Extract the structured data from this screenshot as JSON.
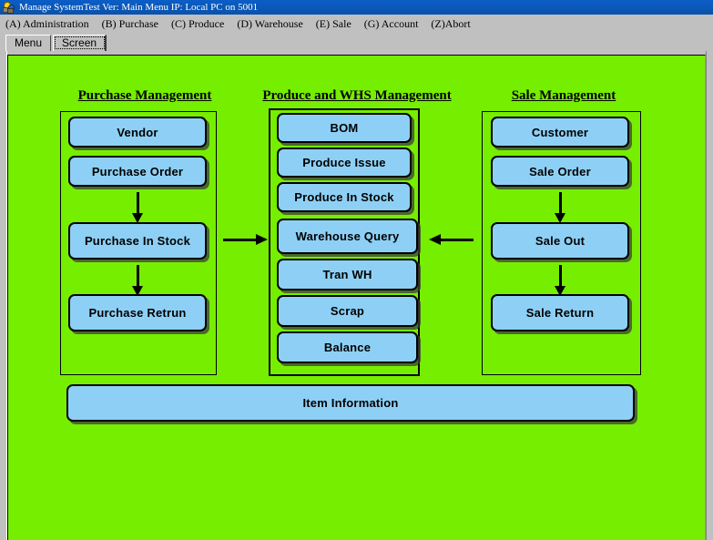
{
  "window": {
    "title": "Manage SystemTest Ver: Main Menu IP: Local PC on 5001",
    "icon": "app-icon",
    "bg_color": "#76ee00",
    "button_color": "#8ed0f5",
    "titlebar_color": "#0a56b5"
  },
  "menubar": {
    "items": [
      {
        "accel": "A",
        "label": "Administration"
      },
      {
        "accel": "B",
        "label": "Purchase"
      },
      {
        "accel": "C",
        "label": "Produce"
      },
      {
        "accel": "D",
        "label": "Warehouse"
      },
      {
        "accel": "E",
        "label": "Sale"
      },
      {
        "accel": "G",
        "label": "Account"
      },
      {
        "accel": "Z",
        "label": "Abort"
      }
    ],
    "rendered": [
      "(A) Administration",
      "(B) Purchase",
      "(C) Produce",
      "(D) Warehouse",
      "(E) Sale",
      "(G) Account",
      "(Z)Abort"
    ]
  },
  "tabs": [
    {
      "label": "Menu",
      "selected": false
    },
    {
      "label": "Screen",
      "selected": true
    }
  ],
  "columns": [
    {
      "heading": "Purchase Management",
      "buttons": [
        "Vendor",
        "Purchase Order",
        "Purchase In Stock",
        "Purchase Retrun"
      ]
    },
    {
      "heading": "Produce and WHS Management",
      "buttons": [
        "BOM",
        "Produce Issue",
        "Produce In Stock",
        "Warehouse Query",
        "Tran WH",
        "Scrap",
        "Balance"
      ]
    },
    {
      "heading": "Sale Management",
      "buttons": [
        "Customer",
        "Sale Order",
        "Sale Out",
        "Sale Return"
      ]
    }
  ],
  "footer": {
    "button": "Item Information"
  }
}
